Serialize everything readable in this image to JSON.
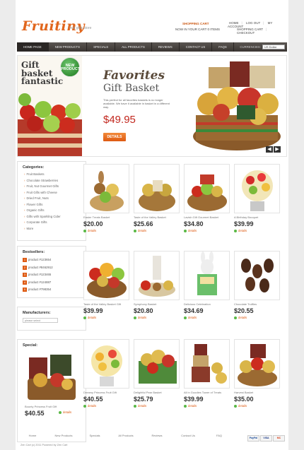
{
  "brand": {
    "logo": "Fruitiny",
    "tagline": "fruit gifts store"
  },
  "cart": {
    "title": "SHOPPING CART",
    "info": "NOW IN YOUR CART 0 ITEMS"
  },
  "toplinks": {
    "home": "HOME",
    "logout": "LOG OUT",
    "account": "MY ACCOUNT",
    "shopping_cart": "SHOPPING CART",
    "checkout": "CHECKOUT"
  },
  "nav": {
    "items": [
      "HOME PAGE",
      "NEW PRODUCTS",
      "SPECIALS",
      "ALL PRODUCTS",
      "REVIEWS",
      "CONTACT US",
      "FAQS"
    ],
    "currency_label": "CURRENCIES:",
    "currency_value": "US Dollar"
  },
  "banner": {
    "promo_line1": "Gift",
    "promo_line2": "basket",
    "promo_line3": "fantastic",
    "badge_line1": "NEW",
    "badge_line2": "PRODUCT",
    "title": "Favorites",
    "subtitle": "Gift Basket",
    "description": "This perfect for all favorites baskets is no longer available. We have it available in basket in a different way.",
    "price": "$49.95",
    "details": "DETAILS",
    "prev": "◀",
    "next": "▶"
  },
  "sidebar": {
    "categories_title": "Categories:",
    "categories": [
      "Fruit Baskets",
      "Chocolate Strawberries",
      "Fruit, Nut Gourmet Gifts",
      "Fruit Gifts with Cheese",
      "Dried Fruit, Nuts",
      "Flower Gifts",
      "Organic Gifts",
      "Gifts with Sparkling Cider",
      "Corporate Gifts",
      "More"
    ],
    "bestsellers_title": "Bestsellers:",
    "bestsellers": [
      {
        "n": "1",
        "label": "product #123654"
      },
      {
        "n": "2",
        "label": "product #8462912"
      },
      {
        "n": "3",
        "label": "product #123465"
      },
      {
        "n": "4",
        "label": "product #124887"
      },
      {
        "n": "5",
        "label": "product #798354"
      }
    ],
    "manufacturers_title": "Manufacturers:",
    "manufacturers_select": "please select",
    "special_title": "Special:",
    "special": {
      "name": "Bounty Princess Fruit Gift",
      "price": "$40.55",
      "details": "details"
    }
  },
  "products": [
    {
      "name": "Easter Treats Basket",
      "price": "$20.00",
      "details": "details"
    },
    {
      "name": "Taste of the Valley Basket",
      "price": "$25.66",
      "details": "details"
    },
    {
      "name": "Lavish Gift Gourmet Basket",
      "price": "$34.80",
      "details": "details"
    },
    {
      "name": "A Birthday Bouquet",
      "price": "$39.99",
      "details": "details"
    },
    {
      "name": "Taste of the Valley Basket Gift",
      "price": "$39.99",
      "details": "details"
    },
    {
      "name": "Symphony Basket",
      "price": "$20.80",
      "details": "details"
    },
    {
      "name": "Delicious Celebration",
      "price": "$34.69",
      "details": "details"
    },
    {
      "name": "Chocolate Truffles",
      "price": "$20.55",
      "details": "details"
    },
    {
      "name": "Dreamy Princess Fruit Gift",
      "price": "$40.55",
      "details": "details"
    },
    {
      "name": "Delightful Pear Basket",
      "price": "$25.79",
      "details": "details"
    },
    {
      "name": "All in Goodies Tower of Treats",
      "price": "$39.99",
      "details": "details"
    },
    {
      "name": "Harvest Basket",
      "price": "$35.00",
      "details": "details"
    }
  ],
  "footer": {
    "links": [
      "Home",
      "New Products",
      "Specials",
      "All Products",
      "Reviews",
      "Contact Us",
      "FAQ"
    ],
    "copyright": "Zen Cart (c) 2011 Powered by Zen Cart",
    "payments": [
      "PayPal",
      "VISA",
      "MC"
    ]
  },
  "colors": {
    "accent": "#de5a12",
    "nav": "#3a3532",
    "price_red": "#c2271e",
    "details_green": "#5ab846"
  }
}
